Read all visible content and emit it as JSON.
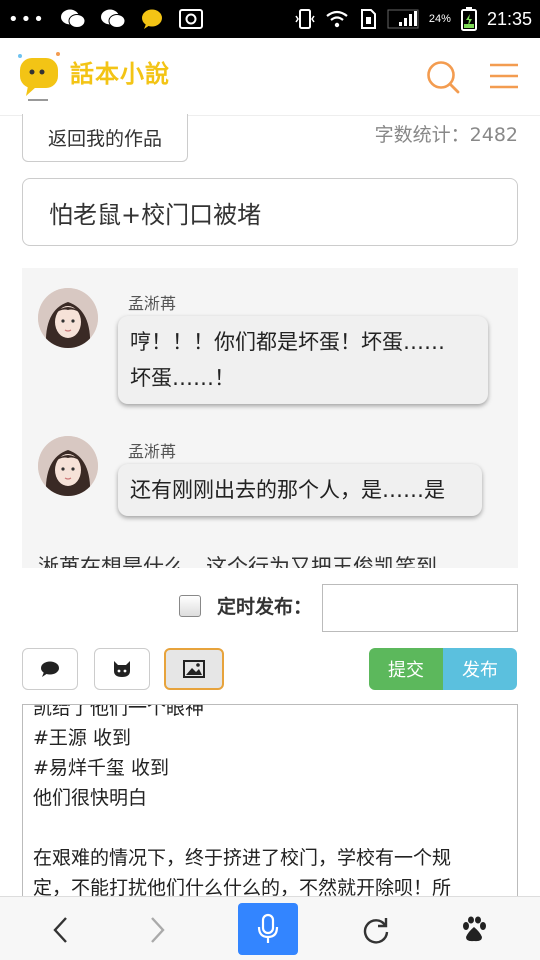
{
  "status_bar": {
    "dots": "•••",
    "time": "21:35",
    "battery": "24%"
  },
  "header": {
    "logo_text": "話本小說"
  },
  "top": {
    "back_label": "返回我的作品",
    "word_count": "字数统计：2482",
    "title": "怕老鼠+校门口被堵"
  },
  "chat": {
    "messages": [
      {
        "name": "孟淅苒",
        "text_line1": "哼！！！你们都是坏蛋！坏蛋……",
        "text_line2": "坏蛋……！"
      },
      {
        "name": "孟淅苒",
        "text_line1": "还有刚刚出去的那个人，是……是"
      }
    ],
    "overflow_text": "淅苒在想是什么，这个行为又把王俊凯笑到"
  },
  "schedule": {
    "label": "定时发布：",
    "input_value": ""
  },
  "toolbar": {
    "submit_label": "提交",
    "publish_label": "发布"
  },
  "editor": {
    "lines": [
      "凯给了他们一个眼神",
      "#王源 收到",
      "#易烊千玺 收到",
      "他们很快明白",
      "",
      "在艰难的情况下，终于挤进了校门，学校有一个规",
      "定，不能打扰他们什么什么的，不然就开除呗！所"
    ]
  },
  "colors": {
    "accent_orange": "#f39c50",
    "logo_yellow": "#f3c415",
    "submit_green": "#5cb85c",
    "publish_blue": "#5bc0de",
    "mic_blue": "#3385ff"
  },
  "icons": {
    "header_search": "search-icon",
    "header_menu": "menu-icon",
    "tool_chat": "chat-bubble-icon",
    "tool_github": "github-cat-icon",
    "tool_image": "image-icon",
    "nav_back": "back-arrow-icon",
    "nav_forward": "forward-arrow-icon",
    "nav_mic": "microphone-icon",
    "nav_refresh": "refresh-icon",
    "nav_baidu": "baidu-paw-icon"
  }
}
